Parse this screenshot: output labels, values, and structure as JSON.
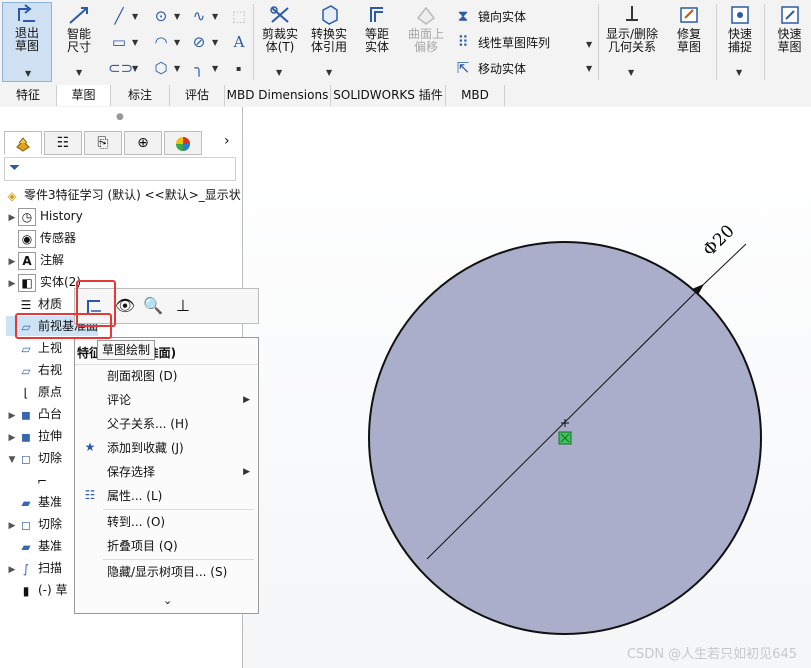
{
  "toolbar": {
    "exit_sketch": "退出草图",
    "smart_dim": "智能尺寸",
    "trim": "剪裁实体(T)",
    "convert": "转换实体引用",
    "offset": "等距实体",
    "surface_offset": "曲面上偏移",
    "mirror": "镜向实体",
    "linear_pattern": "线性草图阵列",
    "move": "移动实体",
    "show_delete": "显示/删除几何关系",
    "repair": "修复草图",
    "quick_snap": "快速捕捉",
    "rapid_sketch": "快速草图"
  },
  "tabs": [
    "特征",
    "草图",
    "标注",
    "评估",
    "MBD Dimensions",
    "SOLIDWORKS 插件",
    "MBD"
  ],
  "active_tab_index": 1,
  "tree": {
    "root": "零件3特征学习 (默认) <<默认>_显示状",
    "items": [
      {
        "label": "History",
        "arrow": true
      },
      {
        "label": "传感器",
        "arrow": false
      },
      {
        "label": "注解",
        "arrow": true
      },
      {
        "label": "实体(2)",
        "arrow": true
      },
      {
        "label": "材质",
        "arrow": false
      },
      {
        "label": "前视基准面",
        "arrow": false
      },
      {
        "label": "上视",
        "arrow": false
      },
      {
        "label": "右视",
        "arrow": false
      },
      {
        "label": "原点",
        "arrow": false
      },
      {
        "label": "凸台",
        "arrow": true
      },
      {
        "label": "拉伸",
        "arrow": true
      },
      {
        "label": "切除",
        "arrow": true
      },
      {
        "label": "",
        "arrow": false
      },
      {
        "label": "基准",
        "arrow": false
      },
      {
        "label": "切除",
        "arrow": true
      },
      {
        "label": "基准",
        "arrow": false
      },
      {
        "label": "扫描",
        "arrow": true
      },
      {
        "label": "(-) 草",
        "arrow": false
      }
    ]
  },
  "tooltip": "草图绘制",
  "context_menu": {
    "header": "特征 (前视基准面)",
    "items": [
      {
        "label": "剖面视图 (D)",
        "submenu": false,
        "icon": ""
      },
      {
        "label": "评论",
        "submenu": true,
        "icon": ""
      },
      {
        "label": "父子关系... (H)",
        "submenu": false,
        "icon": ""
      },
      {
        "label": "添加到收藏 (J)",
        "submenu": false,
        "icon": "star-icon"
      },
      {
        "label": "保存选择",
        "submenu": true,
        "icon": ""
      },
      {
        "label": "属性... (L)",
        "submenu": false,
        "icon": "properties-icon"
      },
      {
        "label": "转到... (O)",
        "submenu": false,
        "icon": ""
      },
      {
        "label": "折叠项目 (Q)",
        "submenu": false,
        "icon": ""
      },
      {
        "label": "隐藏/显示树项目... (S)",
        "submenu": false,
        "icon": ""
      }
    ]
  },
  "sketch": {
    "dimension": "Φ20",
    "circle_fill": "#aaaecb"
  },
  "watermark": "CSDN @人生若只如初见645"
}
